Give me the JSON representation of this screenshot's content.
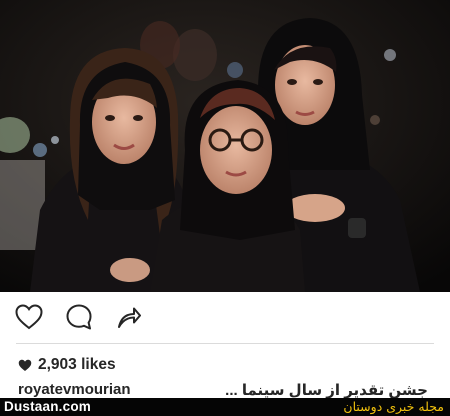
{
  "post": {
    "likes_text": "2,903 likes",
    "username": "royatevmourian",
    "caption": "جشن تقدیر از سال سینما ..."
  },
  "actions": {
    "like_icon": "heart-outline-icon",
    "comment_icon": "comment-bubble-icon",
    "share_icon": "share-arrow-icon"
  },
  "footer": {
    "site": "Dustaan.com",
    "brand": "مجله خبری دوستان"
  },
  "colors": {
    "text": "#262626",
    "divider": "#dbdbdb",
    "footer_bg": "#050505",
    "brand_yellow": "#f2c20d"
  }
}
